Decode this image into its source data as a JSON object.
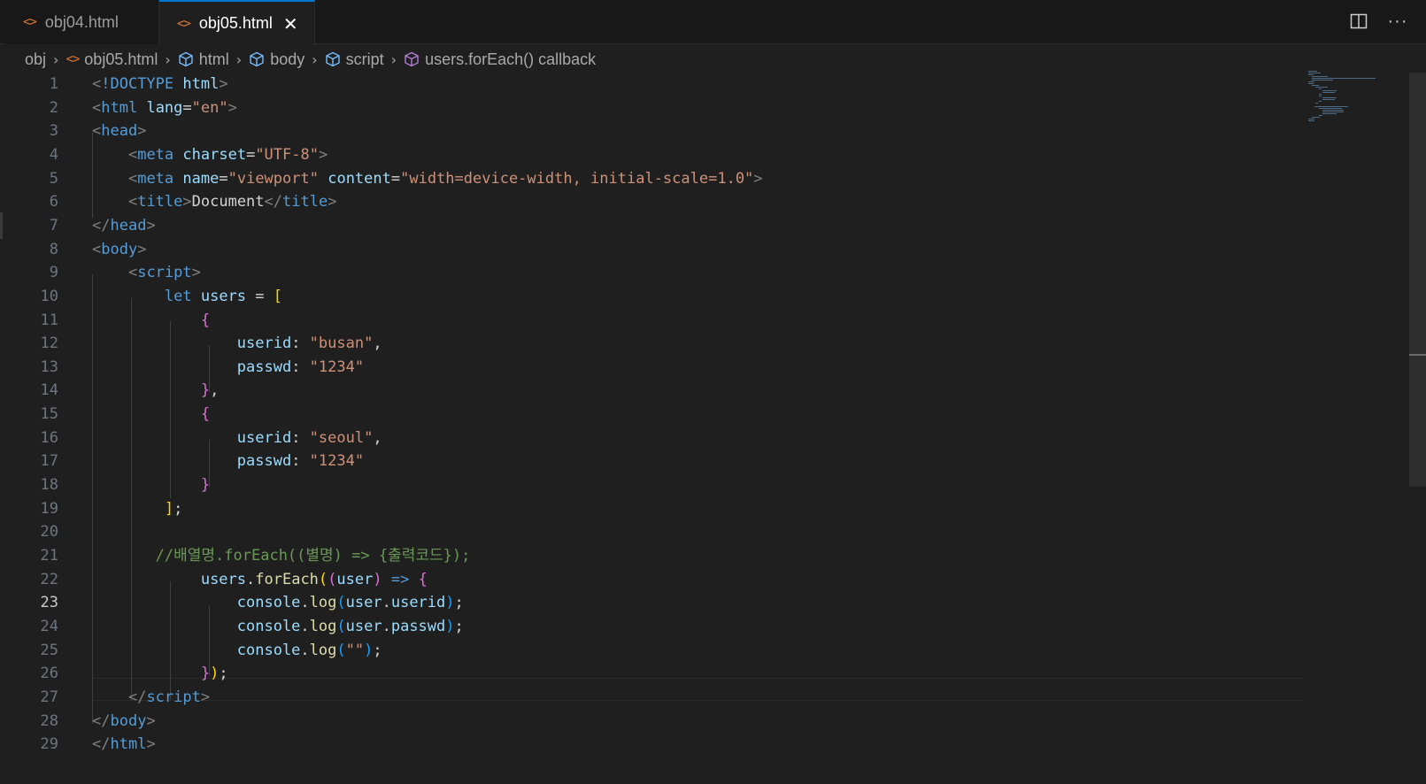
{
  "tabs": [
    {
      "label": "obj04.html",
      "icon": "html-file-icon",
      "active": false
    },
    {
      "label": "obj05.html",
      "icon": "html-file-icon",
      "active": true
    }
  ],
  "tab_icon_glyph": "<>",
  "tab_close_glyph": "✕",
  "actions": {
    "split_icon": "split-editor-icon",
    "more_glyph": "···"
  },
  "breadcrumb": [
    {
      "label": "obj",
      "icon": ""
    },
    {
      "label": "obj05.html",
      "icon": "html-file-icon"
    },
    {
      "label": "html",
      "icon": "cube-icon"
    },
    {
      "label": "body",
      "icon": "cube-icon"
    },
    {
      "label": "script",
      "icon": "cube-icon"
    },
    {
      "label": "users.forEach() callback",
      "icon": "method-icon"
    }
  ],
  "current_line": 23,
  "lines": [
    {
      "n": "1",
      "t": [
        [
          "&lt;",
          "br"
        ],
        [
          "!DOCTYPE",
          "tag"
        ],
        [
          " ",
          "txt"
        ],
        [
          "html",
          "attr"
        ],
        [
          "&gt;",
          "br"
        ]
      ]
    },
    {
      "n": "2",
      "t": [
        [
          "&lt;",
          "br"
        ],
        [
          "html",
          "tag"
        ],
        [
          " ",
          "txt"
        ],
        [
          "lang",
          "attr"
        ],
        [
          "=",
          "txt"
        ],
        [
          "\"en\"",
          "str"
        ],
        [
          "&gt;",
          "br"
        ]
      ]
    },
    {
      "n": "3",
      "t": [
        [
          "&lt;",
          "br"
        ],
        [
          "head",
          "tag"
        ],
        [
          "&gt;",
          "br"
        ]
      ]
    },
    {
      "n": "4",
      "t": [
        [
          "    ",
          "txt"
        ],
        [
          "&lt;",
          "br"
        ],
        [
          "meta",
          "tag"
        ],
        [
          " ",
          "txt"
        ],
        [
          "charset",
          "attr"
        ],
        [
          "=",
          "txt"
        ],
        [
          "\"UTF-8\"",
          "str"
        ],
        [
          "&gt;",
          "br"
        ]
      ]
    },
    {
      "n": "5",
      "t": [
        [
          "    ",
          "txt"
        ],
        [
          "&lt;",
          "br"
        ],
        [
          "meta",
          "tag"
        ],
        [
          " ",
          "txt"
        ],
        [
          "name",
          "attr"
        ],
        [
          "=",
          "txt"
        ],
        [
          "\"viewport\"",
          "str"
        ],
        [
          " ",
          "txt"
        ],
        [
          "content",
          "attr"
        ],
        [
          "=",
          "txt"
        ],
        [
          "\"width=device-width, initial-scale=1.0\"",
          "str"
        ],
        [
          "&gt;",
          "br"
        ]
      ]
    },
    {
      "n": "6",
      "t": [
        [
          "    ",
          "txt"
        ],
        [
          "&lt;",
          "br"
        ],
        [
          "title",
          "tag"
        ],
        [
          "&gt;",
          "br"
        ],
        [
          "Document",
          "txt"
        ],
        [
          "&lt;/",
          "br"
        ],
        [
          "title",
          "tag"
        ],
        [
          "&gt;",
          "br"
        ]
      ]
    },
    {
      "n": "7",
      "t": [
        [
          "&lt;/",
          "br"
        ],
        [
          "head",
          "tag"
        ],
        [
          "&gt;",
          "br"
        ]
      ]
    },
    {
      "n": "8",
      "t": [
        [
          "&lt;",
          "br"
        ],
        [
          "body",
          "tag"
        ],
        [
          "&gt;",
          "br"
        ]
      ]
    },
    {
      "n": "9",
      "t": [
        [
          "    ",
          "txt"
        ],
        [
          "&lt;",
          "br"
        ],
        [
          "script",
          "tag"
        ],
        [
          "&gt;",
          "br"
        ]
      ]
    },
    {
      "n": "10",
      "t": [
        [
          "        ",
          "txt"
        ],
        [
          "let",
          "kw"
        ],
        [
          " ",
          "txt"
        ],
        [
          "users",
          "var"
        ],
        [
          " = ",
          "txt"
        ],
        [
          "[",
          "b1"
        ]
      ]
    },
    {
      "n": "11",
      "t": [
        [
          "            ",
          "txt"
        ],
        [
          "{",
          "b2"
        ]
      ]
    },
    {
      "n": "12",
      "t": [
        [
          "                ",
          "txt"
        ],
        [
          "userid",
          "var"
        ],
        [
          ": ",
          "txt"
        ],
        [
          "\"busan\"",
          "str"
        ],
        [
          ",",
          "txt"
        ]
      ]
    },
    {
      "n": "13",
      "t": [
        [
          "                ",
          "txt"
        ],
        [
          "passwd",
          "var"
        ],
        [
          ": ",
          "txt"
        ],
        [
          "\"1234\"",
          "str"
        ]
      ]
    },
    {
      "n": "14",
      "t": [
        [
          "            ",
          "txt"
        ],
        [
          "}",
          "b2"
        ],
        [
          ",",
          "txt"
        ]
      ]
    },
    {
      "n": "15",
      "t": [
        [
          "            ",
          "txt"
        ],
        [
          "{",
          "b2"
        ]
      ]
    },
    {
      "n": "16",
      "t": [
        [
          "                ",
          "txt"
        ],
        [
          "userid",
          "var"
        ],
        [
          ": ",
          "txt"
        ],
        [
          "\"seoul\"",
          "str"
        ],
        [
          ",",
          "txt"
        ]
      ]
    },
    {
      "n": "17",
      "t": [
        [
          "                ",
          "txt"
        ],
        [
          "passwd",
          "var"
        ],
        [
          ": ",
          "txt"
        ],
        [
          "\"1234\"",
          "str"
        ]
      ]
    },
    {
      "n": "18",
      "t": [
        [
          "            ",
          "txt"
        ],
        [
          "}",
          "b2"
        ]
      ]
    },
    {
      "n": "19",
      "t": [
        [
          "        ",
          "txt"
        ],
        [
          "]",
          "b1"
        ],
        [
          ";",
          "txt"
        ]
      ]
    },
    {
      "n": "20",
      "t": []
    },
    {
      "n": "21",
      "t": [
        [
          "       ",
          "txt"
        ],
        [
          "//배열명.forEach((별명) =&gt; {출력코드});",
          "com"
        ]
      ]
    },
    {
      "n": "22",
      "t": [
        [
          "            ",
          "txt"
        ],
        [
          "users",
          "var"
        ],
        [
          ".",
          "txt"
        ],
        [
          "forEach",
          "fn"
        ],
        [
          "(",
          "b1"
        ],
        [
          "(",
          "b2"
        ],
        [
          "user",
          "var"
        ],
        [
          ")",
          "b2"
        ],
        [
          " ",
          "txt"
        ],
        [
          "=&gt;",
          "kw"
        ],
        [
          " ",
          "txt"
        ],
        [
          "{",
          "b2"
        ]
      ]
    },
    {
      "n": "23",
      "t": [
        [
          "                ",
          "txt"
        ],
        [
          "console",
          "var"
        ],
        [
          ".",
          "txt"
        ],
        [
          "log",
          "fn"
        ],
        [
          "(",
          "b3"
        ],
        [
          "user",
          "var"
        ],
        [
          ".",
          "txt"
        ],
        [
          "userid",
          "var"
        ],
        [
          ")",
          "b3"
        ],
        [
          ";",
          "txt"
        ]
      ]
    },
    {
      "n": "24",
      "t": [
        [
          "                ",
          "txt"
        ],
        [
          "console",
          "var"
        ],
        [
          ".",
          "txt"
        ],
        [
          "log",
          "fn"
        ],
        [
          "(",
          "b3"
        ],
        [
          "user",
          "var"
        ],
        [
          ".",
          "txt"
        ],
        [
          "passwd",
          "var"
        ],
        [
          ")",
          "b3"
        ],
        [
          ";",
          "txt"
        ]
      ]
    },
    {
      "n": "25",
      "t": [
        [
          "                ",
          "txt"
        ],
        [
          "console",
          "var"
        ],
        [
          ".",
          "txt"
        ],
        [
          "log",
          "fn"
        ],
        [
          "(",
          "b3"
        ],
        [
          "\"\"",
          "str"
        ],
        [
          ")",
          "b3"
        ],
        [
          ";",
          "txt"
        ]
      ]
    },
    {
      "n": "26",
      "t": [
        [
          "            ",
          "txt"
        ],
        [
          "}",
          "b2"
        ],
        [
          ")",
          "b1"
        ],
        [
          ";",
          "txt"
        ]
      ]
    },
    {
      "n": "27",
      "t": [
        [
          "    ",
          "txt"
        ],
        [
          "&lt;/",
          "br"
        ],
        [
          "script",
          "tag"
        ],
        [
          "&gt;",
          "br"
        ]
      ]
    },
    {
      "n": "28",
      "t": [
        [
          "&lt;/",
          "br"
        ],
        [
          "body",
          "tag"
        ],
        [
          "&gt;",
          "br"
        ]
      ]
    },
    {
      "n": "29",
      "t": [
        [
          "&lt;/",
          "br"
        ],
        [
          "html",
          "tag"
        ],
        [
          "&gt;",
          "br"
        ]
      ]
    }
  ]
}
